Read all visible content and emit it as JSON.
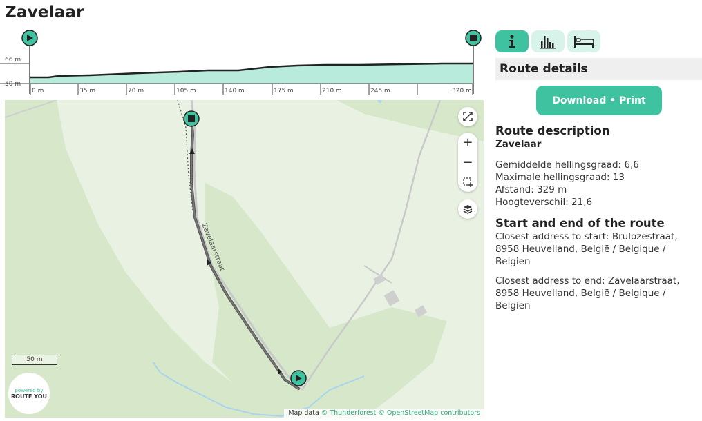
{
  "page": {
    "title": "Zavelaar"
  },
  "elevation": {
    "y_labels": [
      "66 m",
      "50 m"
    ],
    "x_ticks": [
      "0 m",
      "35 m",
      "70 m",
      "105 m",
      "140 m",
      "175 m",
      "210 m",
      "245 m",
      "320 m"
    ],
    "start_icon": "play-icon",
    "end_icon": "stop-icon",
    "fill_color": "#b8ebdb",
    "line_color": "#222222"
  },
  "map": {
    "street_label": "Zavelaarstraat",
    "scale_label": "50 m",
    "powered_by": "powered by",
    "brand": "ROUTE YOU",
    "attribution": {
      "prefix": "Map data",
      "thunderforest": "© Thunderforest",
      "osm": "© OpenStreetMap contributors"
    },
    "controls": [
      "fullscreen-icon",
      "zoom-in-icon",
      "zoom-out-icon",
      "box-select-icon",
      "layers-icon"
    ]
  },
  "panel": {
    "tabs": [
      {
        "name": "info",
        "icon": "info-icon",
        "active": true
      },
      {
        "name": "stats",
        "icon": "bar-chart-icon",
        "active": false
      },
      {
        "name": "lodging",
        "icon": "bed-icon",
        "active": false
      }
    ],
    "section_title": "Route details",
    "download_label": "Download • Print",
    "description_title": "Route description",
    "description_name": "Zavelaar",
    "stats": [
      "Gemiddelde hellingsgraad: 6,6",
      "Maximale hellingsgraad: 13",
      "Afstand: 329 m",
      "Hoogteverschil: 21,6"
    ],
    "start_end_title": "Start and end of the route",
    "start_address": "Closest address to start: Brulozestraat, 8958 Heuvelland, België / Belgique / Belgien",
    "end_address": "Closest address to end: Zavelaarstraat, 8958 Heuvelland, België / Belgique / Belgien"
  },
  "colors": {
    "accent": "#3fc2a0",
    "accent_light": "#d7f3ea",
    "map_bg": "#e9f2e2",
    "map_forest": "#d6e8c9"
  }
}
